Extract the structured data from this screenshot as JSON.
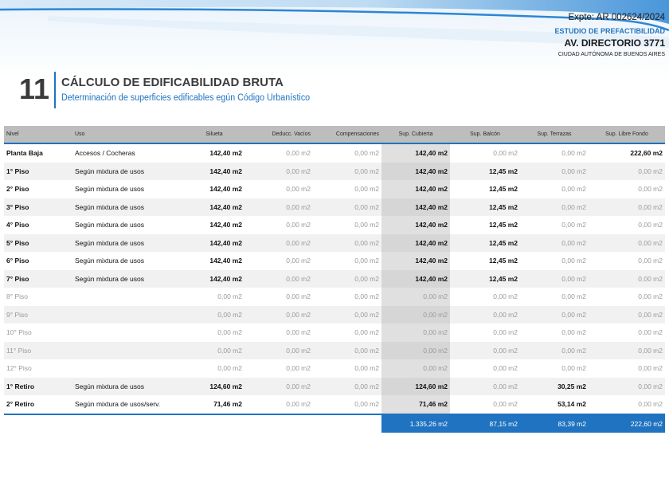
{
  "header": {
    "expte": "Expte: AR 002624/2024",
    "estudio": "ESTUDIO DE PREFACTIBILIDAD",
    "address": "AV. DIRECTORIO 3771",
    "city": "CIUDAD AUTÓNOMA DE BUENOS AIRES"
  },
  "section": {
    "number": "11",
    "title": "CÁLCULO DE EDIFICABILIDAD BRUTA",
    "subtitle": "Determinación de superficies edificables egún Código Urbanístico"
  },
  "colors": {
    "accent": "#1f73c0",
    "header_gray": "#bdbdbd"
  },
  "table": {
    "columns": [
      "Nivel",
      "Uso",
      "Silueta",
      "Deducc. Vacíos",
      "Compensaciones",
      "Sup. Cubierta",
      "Sup. Balcón",
      "Sup. Terrazas",
      "Sup. Libre Fondo"
    ],
    "rows": [
      {
        "nivel": "Planta Baja",
        "uso": "Accesos / Cocheras",
        "silueta": "142,40 m2",
        "vacios": "0,00 m2",
        "comp": "0,00 m2",
        "cubierta": "142,40 m2",
        "balcon": "0,00 m2",
        "terrazas": "0,00 m2",
        "fondo": "222,60 m2"
      },
      {
        "nivel": "1° Piso",
        "uso": "Según mixtura de usos",
        "silueta": "142,40 m2",
        "vacios": "0,00 m2",
        "comp": "0,00 m2",
        "cubierta": "142,40 m2",
        "balcon": "12,45 m2",
        "terrazas": "0,00 m2",
        "fondo": "0,00 m2"
      },
      {
        "nivel": "2° Piso",
        "uso": "Según mixtura de usos",
        "silueta": "142,40 m2",
        "vacios": "0,00 m2",
        "comp": "0,00 m2",
        "cubierta": "142,40 m2",
        "balcon": "12,45 m2",
        "terrazas": "0,00 m2",
        "fondo": "0,00 m2"
      },
      {
        "nivel": "3° Piso",
        "uso": "Según mixtura de usos",
        "silueta": "142,40 m2",
        "vacios": "0,00 m2",
        "comp": "0,00 m2",
        "cubierta": "142,40 m2",
        "balcon": "12,45 m2",
        "terrazas": "0,00 m2",
        "fondo": "0,00 m2"
      },
      {
        "nivel": "4° Piso",
        "uso": "Según mixtura de usos",
        "silueta": "142,40 m2",
        "vacios": "0,00 m2",
        "comp": "0,00 m2",
        "cubierta": "142,40 m2",
        "balcon": "12,45 m2",
        "terrazas": "0,00 m2",
        "fondo": "0,00 m2"
      },
      {
        "nivel": "5° Piso",
        "uso": "Según mixtura de usos",
        "silueta": "142,40 m2",
        "vacios": "0,00 m2",
        "comp": "0,00 m2",
        "cubierta": "142,40 m2",
        "balcon": "12,45 m2",
        "terrazas": "0,00 m2",
        "fondo": "0,00 m2"
      },
      {
        "nivel": "6° Piso",
        "uso": "Según mixtura de usos",
        "silueta": "142,40 m2",
        "vacios": "0,00 m2",
        "comp": "0,00 m2",
        "cubierta": "142,40 m2",
        "balcon": "12,45 m2",
        "terrazas": "0,00 m2",
        "fondo": "0,00 m2"
      },
      {
        "nivel": "7° Piso",
        "uso": "Según mixtura de usos",
        "silueta": "142,40 m2",
        "vacios": "0,00 m2",
        "comp": "0,00 m2",
        "cubierta": "142,40 m2",
        "balcon": "12,45 m2",
        "terrazas": "0,00 m2",
        "fondo": "0,00 m2"
      },
      {
        "nivel": "8° Piso",
        "uso": "",
        "silueta": "0,00 m2",
        "vacios": "0,00 m2",
        "comp": "0,00 m2",
        "cubierta": "0,00 m2",
        "balcon": "0,00 m2",
        "terrazas": "0,00 m2",
        "fondo": "0,00 m2"
      },
      {
        "nivel": "9° Piso",
        "uso": "",
        "silueta": "0,00 m2",
        "vacios": "0,00 m2",
        "comp": "0,00 m2",
        "cubierta": "0,00 m2",
        "balcon": "0,00 m2",
        "terrazas": "0,00 m2",
        "fondo": "0,00 m2"
      },
      {
        "nivel": "10° Piso",
        "uso": "",
        "silueta": "0,00 m2",
        "vacios": "0,00 m2",
        "comp": "0,00 m2",
        "cubierta": "0,00 m2",
        "balcon": "0,00 m2",
        "terrazas": "0,00 m2",
        "fondo": "0,00 m2"
      },
      {
        "nivel": "11° Piso",
        "uso": "",
        "silueta": "0,00 m2",
        "vacios": "0,00 m2",
        "comp": "0,00 m2",
        "cubierta": "0,00 m2",
        "balcon": "0,00 m2",
        "terrazas": "0,00 m2",
        "fondo": "0,00 m2"
      },
      {
        "nivel": "12° Piso",
        "uso": "",
        "silueta": "0,00 m2",
        "vacios": "0,00 m2",
        "comp": "0,00 m2",
        "cubierta": "0,00 m2",
        "balcon": "0,00 m2",
        "terrazas": "0,00 m2",
        "fondo": "0,00 m2"
      },
      {
        "nivel": "1° Retiro",
        "uso": "Según mixtura de usos",
        "silueta": "124,60 m2",
        "vacios": "0,00 m2",
        "comp": "0,00 m2",
        "cubierta": "124,60 m2",
        "balcon": "0,00 m2",
        "terrazas": "30,25 m2",
        "fondo": "0,00 m2"
      },
      {
        "nivel": "2° Retiro",
        "uso": "Según mixtura de usos/serv.",
        "silueta": "71,46 m2",
        "vacios": "0,00 m2",
        "comp": "0,00 m2",
        "cubierta": "71,46 m2",
        "balcon": "0,00 m2",
        "terrazas": "53,14 m2",
        "fondo": "0,00 m2"
      }
    ],
    "totals": {
      "cubierta": "1.335,26 m2",
      "balcon": "87,15 m2",
      "terrazas": "83,39 m2",
      "fondo": "222,60 m2"
    }
  }
}
